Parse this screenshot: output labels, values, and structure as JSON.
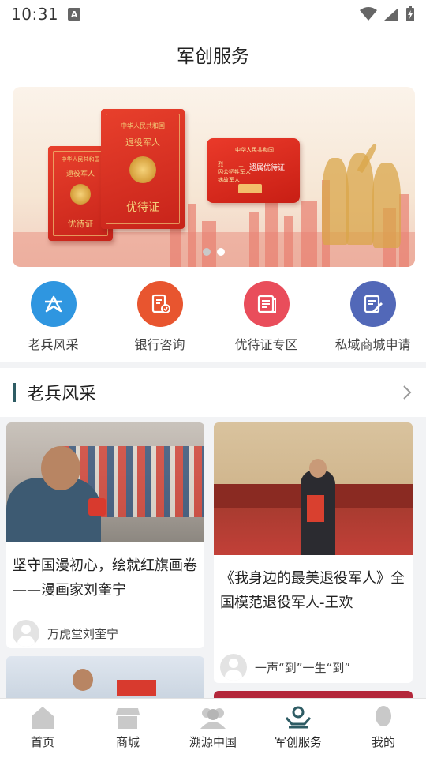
{
  "status": {
    "time": "10:31",
    "notification_icon": "A"
  },
  "header": {
    "title": "军创服务"
  },
  "banner": {
    "cert_left": {
      "line1": "中华人民共和国",
      "line2": "退役军人",
      "line3": "优待证"
    },
    "cert_right": {
      "line1": "中华人民共和国",
      "line2": "退役军人",
      "line3": "优待证"
    },
    "card": {
      "line1": "中华人民共和国",
      "line2": "烈",
      "line3": "士",
      "line4": "因公牺牲军人",
      "line5": "病故军人",
      "big": "遗属优待证"
    },
    "slide_count": 2,
    "active_slide": 0
  },
  "quick_links": [
    {
      "label": "老兵风采",
      "icon": "star-badge-icon",
      "color": "#2f96e0"
    },
    {
      "label": "银行咨询",
      "icon": "bank-card-icon",
      "color": "#e8552f"
    },
    {
      "label": "优待证专区",
      "icon": "news-card-icon",
      "color": "#e94d5b"
    },
    {
      "label": "私域商城申请",
      "icon": "edit-form-icon",
      "color": "#5268b8"
    }
  ],
  "section": {
    "title": "老兵风采"
  },
  "articles": [
    {
      "title": "坚守国漫初心，绘就红旗画卷——漫画家刘奎宁",
      "author": "万虎堂刘奎宁"
    },
    {
      "title": "《我身边的最美退役军人》全国模范退役军人-王欢",
      "author": "一声“到”一生“到”"
    }
  ],
  "tabs": [
    {
      "label": "首页",
      "icon": "home-icon"
    },
    {
      "label": "商城",
      "icon": "shop-icon"
    },
    {
      "label": "溯源中国",
      "icon": "group-icon"
    },
    {
      "label": "军创服务",
      "icon": "care-hand-icon"
    },
    {
      "label": "我的",
      "icon": "user-icon"
    }
  ],
  "colors": {
    "accent": "#2e5c64",
    "banner_red": "#d9301f"
  }
}
